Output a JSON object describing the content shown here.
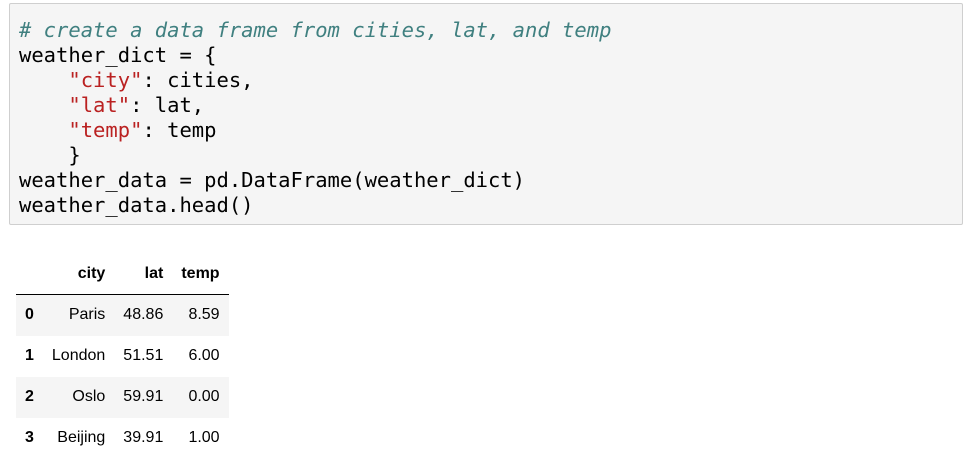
{
  "code_cell": {
    "lines": [
      {
        "comment": "# create a data frame from cities, lat, and temp"
      },
      {
        "plain": "weather_dict = {"
      },
      {
        "indent": "    ",
        "string": "\"city\"",
        "rest": ": cities,"
      },
      {
        "indent": "    ",
        "string": "\"lat\"",
        "rest": ": lat,"
      },
      {
        "indent": "    ",
        "string": "\"temp\"",
        "rest": ": temp"
      },
      {
        "plain": "    }"
      },
      {
        "plain": "weather_data = pd.DataFrame(weather_dict)"
      },
      {
        "plain": "weather_data.head()"
      }
    ],
    "colors": {
      "background": "#f5f5f5",
      "border": "#cfcfcf",
      "comment": "#408080",
      "string": "#ba2121"
    }
  },
  "dataframe": {
    "columns": [
      "",
      "city",
      "lat",
      "temp"
    ],
    "rows": [
      {
        "index": "0",
        "city": "Paris",
        "lat": "48.86",
        "temp": "8.59"
      },
      {
        "index": "1",
        "city": "London",
        "lat": "51.51",
        "temp": "6.00"
      },
      {
        "index": "2",
        "city": "Oslo",
        "lat": "59.91",
        "temp": "0.00"
      },
      {
        "index": "3",
        "city": "Beijing",
        "lat": "39.91",
        "temp": "1.00"
      }
    ]
  }
}
